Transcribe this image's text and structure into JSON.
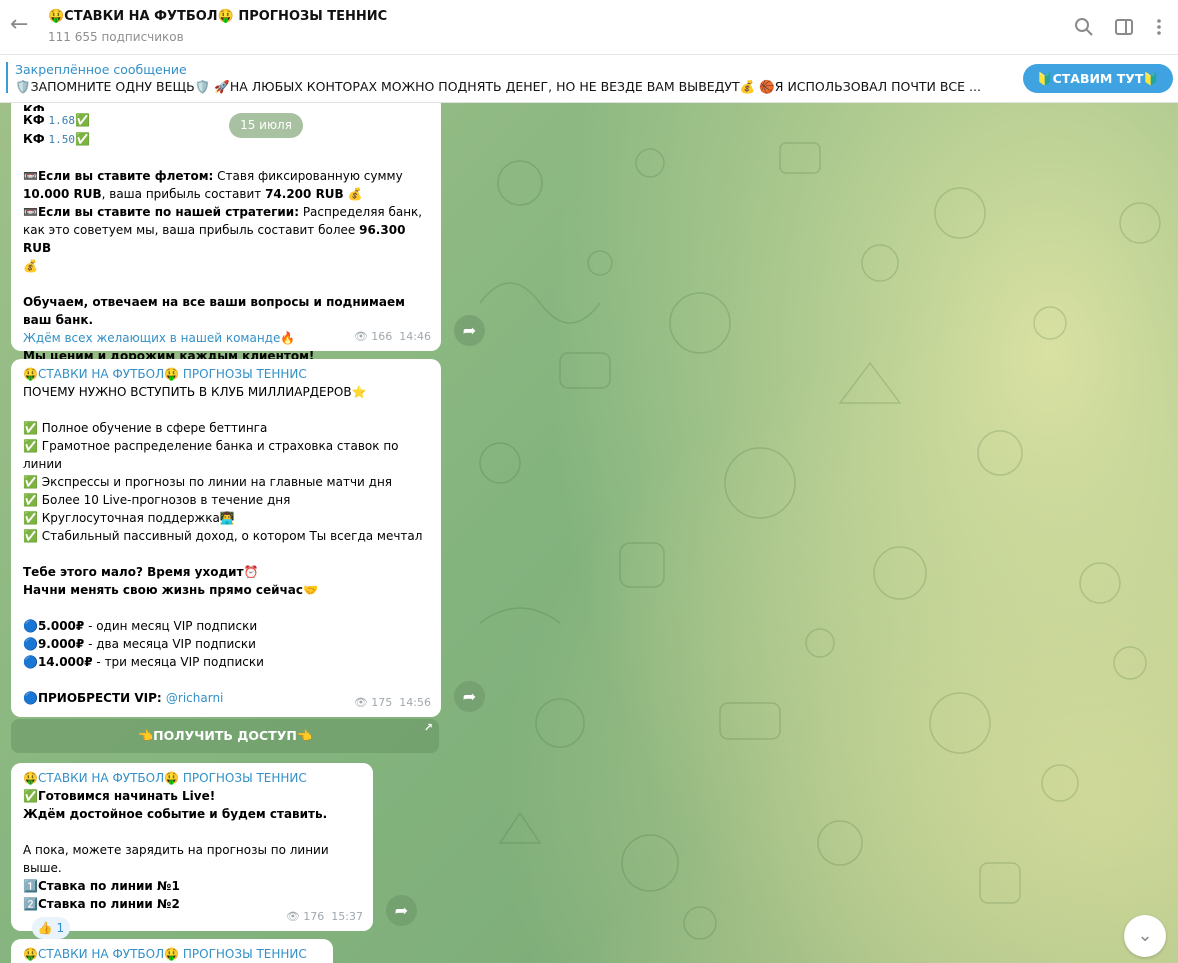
{
  "header": {
    "back_icon": "←",
    "title": "🤑СТАВКИ НА ФУТБОЛ🤑 ПРОГНОЗЫ ТЕННИС",
    "subscribers": "111 655 подписчиков"
  },
  "pinned": {
    "label": "Закреплённое сообщение",
    "text": "🛡️ЗАПОМНИТЕ ОДНУ ВЕЩЬ🛡️ 🚀НА ЛЮБЫХ КОНТОРАХ МОЖНО ПОДНЯТЬ ДЕНЕГ, НО НЕ ВЕЗДЕ ВАМ ВЫВЕДУТ💰 🏀Я ИСПОЛЬЗОВАЛ ПОЧТИ ВСЕ ...",
    "button": "🔰СТАВИМ ТУТ🔰"
  },
  "date_chip": "15 июля",
  "msg1": {
    "lines": [
      "КФ 1.68✅",
      "КФ 1.50✅"
    ],
    "kf_label": "КФ",
    "kf1": "1.68",
    "kf2": "1.50",
    "check": "✅",
    "flat_title": "📼Если вы ставите флетом:",
    "flat_text": " Ставя фиксированную сумму ",
    "flat_sum": "10.000 RUB",
    "flat_text2": ", ваша прибыль составит ",
    "flat_profit": "74.200 RUB",
    "bag": "💰",
    "strat_title": "📼Если вы ставите по нашей стратегии:",
    "strat_text": " Распределяя банк, как это советуем мы, ваша прибыль составит более ",
    "strat_profit": "96.300 RUB",
    "teach": "Обучаем, отвечаем на все ваши вопросы и поднимаем ваш банк.",
    "link": "Ждём всех желающих в нашей команде",
    "fire": "🔥",
    "value": "Мы ценим и дорожим каждым клиентом!",
    "views": "166",
    "time": "14:46"
  },
  "msg2": {
    "sender": "🤑СТАВКИ НА ФУТБОЛ🤑 ПРОГНОЗЫ ТЕННИС",
    "heading": "ПОЧЕМУ НУЖНО ВСТУПИТЬ В КЛУБ МИЛЛИАРДЕРОВ⭐",
    "items": [
      "✅ Полное обучение в сфере беттинга",
      "✅ Грамотное распределение банка и страховка ставок по линии",
      "✅ Экспрессы и прогнозы по линии на главные матчи дня",
      "✅ Более 10 Live-прогнозов в течение дня",
      "✅ Круглосуточная поддержка👨‍💻",
      "✅ Стабильный пассивный доход, о котором Ты всегда мечтал"
    ],
    "hurry1": "Тебе этого мало? Время уходит⏰",
    "hurry2": "Начни менять свою жизнь прямо сейчас🤝",
    "prices": [
      {
        "price": "🔵5.000₽",
        "text": " - один месяц VIP подписки"
      },
      {
        "price": "🔵9.000₽",
        "text": " - два месяца VIP подписки"
      },
      {
        "price": "🔵14.000₽",
        "text": " - три месяца VIP подписки"
      }
    ],
    "buy_label": "🔵ПРИОБРЕСТИ VIP: ",
    "buy_link": "@richarni",
    "views": "175",
    "time": "14:56",
    "button": "👈ПОЛУЧИТЬ ДОСТУП👈",
    "button_arrow": "↗"
  },
  "msg3": {
    "sender": "🤑СТАВКИ НА ФУТБОЛ🤑 ПРОГНОЗЫ ТЕННИС",
    "line1": "✅Готовимся начинать Live!",
    "line2": "Ждём достойное событие и будем ставить.",
    "line3": "А пока, можете зарядить на прогнозы по линии выше.",
    "line4": "1️⃣Ставка по линии №1",
    "line5": "2️⃣Ставка по линии №2",
    "reaction": "👍 1",
    "views": "176",
    "time": "15:37"
  },
  "msg4": {
    "sender": "🤑СТАВКИ НА ФУТБОЛ🤑 ПРОГНОЗЫ ТЕННИС"
  },
  "icons": {
    "search": "search-icon",
    "sidebar": "sidebar-toggle-icon",
    "more": "more-vertical-icon",
    "forward": "forward-icon",
    "eye": "eye-icon",
    "scroll": "chevron-down-icon"
  }
}
